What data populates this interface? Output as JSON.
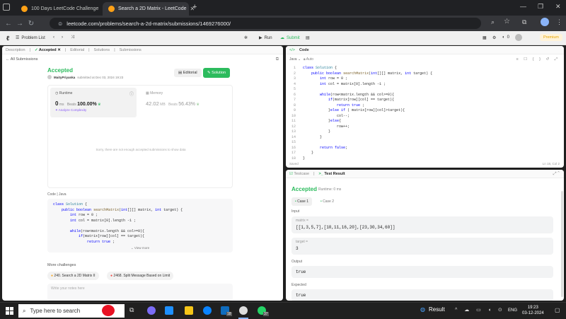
{
  "browser": {
    "tabs": [
      {
        "label": "100 Days LeetCode Challenge"
      },
      {
        "label": "Search a 2D Matrix - LeetCode"
      }
    ],
    "url": "leetcode.com/problems/search-a-2d-matrix/submissions/1469276000/"
  },
  "lc_header": {
    "problem_list": "Problem List",
    "run": "Run",
    "submit": "Submit",
    "count": "0",
    "premium": "Premium"
  },
  "left_panel": {
    "tabs": [
      "Description",
      "Accepted",
      "Editorial",
      "Solutions",
      "Submissions"
    ],
    "all_submissions": "All Submissions",
    "status": "Accepted",
    "author": "MaityPriyanka",
    "submitted": "submitted at Dec 03, 2024 19:23",
    "editorial_btn": "Editorial",
    "solution_btn": "Solution",
    "runtime_label": "Runtime",
    "runtime_value": "0",
    "runtime_unit": "ms",
    "runtime_beats_label": "Beats",
    "runtime_beats": "100.00%",
    "analyze": "Analyze Complexity",
    "memory_label": "Memory",
    "memory_value": "42.02",
    "memory_unit": "MB",
    "memory_beats_label": "Beats",
    "memory_beats": "56.43%",
    "empty_msg": "Sorry, there are not enough accepted submissions to show data",
    "code_label": "Code",
    "code_lang": "Java",
    "code_lines": [
      "class Solution {",
      "    public boolean searchMatrix(int[][] matrix, int target) {",
      "        int row = 0 ;",
      "        int col = matrix[0].length -1 ;",
      "",
      "        while(row<matrix.length && col>=0){",
      "            if(matrix[row][col] == target){",
      "                return true ;"
    ],
    "view_more": "View more",
    "more_challenges": "More challenges",
    "challenges": [
      "240. Search a 2D Matrix II",
      "2468. Split Message Based on Limit"
    ],
    "notes_placeholder": "Write your notes here"
  },
  "editor": {
    "title": "Code",
    "lang": "Java",
    "mode": "Auto",
    "lines": [
      "class Solution {",
      "    public boolean searchMatrix(int[][] matrix, int target) {",
      "        int row = 0 ;",
      "        int col = matrix[0].length -1 ;",
      "",
      "        while(row<matrix.length && col>=0){",
      "            if(matrix[row][col] == target){",
      "                return true ;",
      "            }else if ( matrix[row][col]>target){",
      "                col--;",
      "            }else{",
      "                row++;",
      "            }",
      "        }",
      "",
      "        return false;",
      "    }",
      "}"
    ],
    "saved": "Saved",
    "cursor": "Ln 18, Col 2"
  },
  "result": {
    "tab_testcase": "Testcase",
    "tab_result": "Test Result",
    "status": "Accepted",
    "runtime": "Runtime: 0 ms",
    "case1": "Case 1",
    "case2": "Case 2",
    "input_label": "Input",
    "matrix_label": "matrix =",
    "matrix_value": "[[1,3,5,7],[10,11,16,20],[23,30,34,60]]",
    "target_label": "target =",
    "target_value": "3",
    "output_label": "Output",
    "output_value": "true",
    "expected_label": "Expected",
    "expected_value": "true"
  },
  "taskbar": {
    "search": "Type here to search",
    "weather": "Result",
    "lang": "ENG",
    "time": "19:23",
    "date": "03-12-2024",
    "badge1": "18",
    "badge2": "37"
  }
}
